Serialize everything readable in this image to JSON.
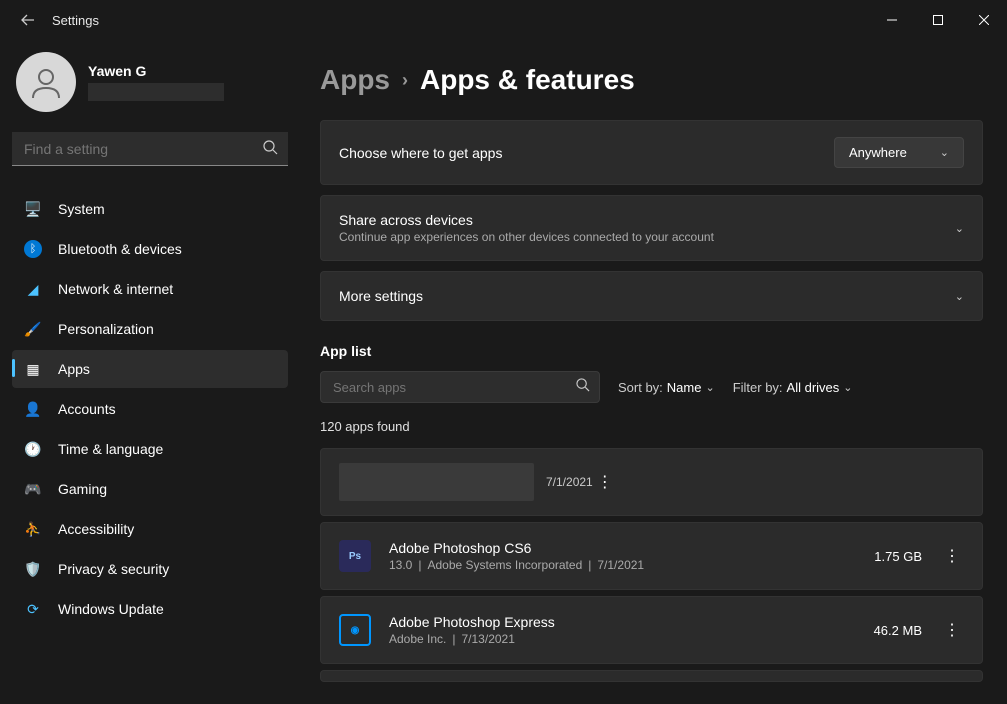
{
  "titlebar": {
    "title": "Settings"
  },
  "profile": {
    "username": "Yawen G"
  },
  "search": {
    "placeholder": "Find a setting"
  },
  "nav": [
    {
      "label": "System"
    },
    {
      "label": "Bluetooth & devices"
    },
    {
      "label": "Network & internet"
    },
    {
      "label": "Personalization"
    },
    {
      "label": "Apps"
    },
    {
      "label": "Accounts"
    },
    {
      "label": "Time & language"
    },
    {
      "label": "Gaming"
    },
    {
      "label": "Accessibility"
    },
    {
      "label": "Privacy & security"
    },
    {
      "label": "Windows Update"
    }
  ],
  "breadcrumb": {
    "parent": "Apps",
    "current": "Apps & features"
  },
  "cards": {
    "source": {
      "label": "Choose where to get apps",
      "value": "Anywhere"
    },
    "share": {
      "label": "Share across devices",
      "sub": "Continue app experiences on other devices connected to your account"
    },
    "more": {
      "label": "More settings"
    }
  },
  "applist": {
    "title": "App list",
    "search_placeholder": "Search apps",
    "sort_label": "Sort by:",
    "sort_value": "Name",
    "filter_label": "Filter by:",
    "filter_value": "All drives",
    "count": "120 apps found"
  },
  "apps": [
    {
      "date": "7/1/2021"
    },
    {
      "name": "Adobe Photoshop CS6",
      "version": "13.0",
      "publisher": "Adobe Systems Incorporated",
      "date": "7/1/2021",
      "size": "1.75 GB",
      "icon_bg": "#2a2a5a",
      "icon_text": "Ps"
    },
    {
      "name": "Adobe Photoshop Express",
      "publisher": "Adobe Inc.",
      "date": "7/13/2021",
      "size": "46.2 MB",
      "icon_bg": "#1a1a1a",
      "icon_border": "#0096ff",
      "icon_text": "◉"
    }
  ]
}
